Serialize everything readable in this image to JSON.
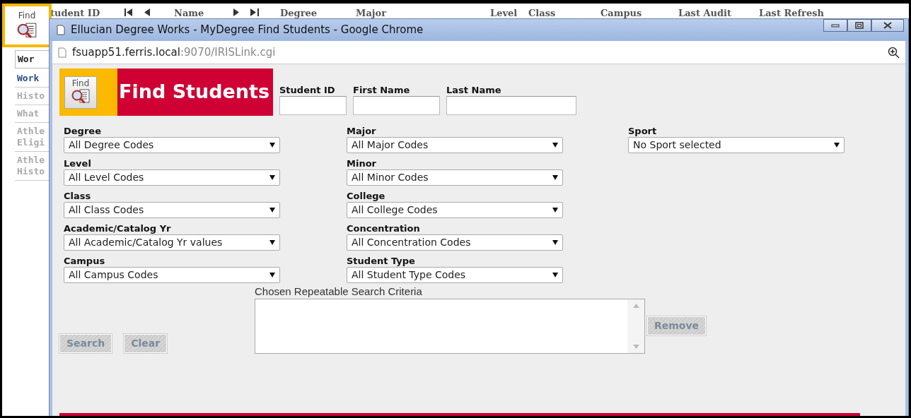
{
  "background_app": {
    "find_button": {
      "label": "Find"
    },
    "columns": [
      {
        "label": "tudent ID",
        "kind": "text"
      },
      {
        "kind": "nav_back"
      },
      {
        "label": "Name",
        "kind": "text"
      },
      {
        "kind": "nav_forward"
      },
      {
        "label": "Degree",
        "kind": "text"
      },
      {
        "label": "Major",
        "kind": "text"
      },
      {
        "label": "Level",
        "kind": "text"
      },
      {
        "label": "Class",
        "kind": "text"
      },
      {
        "label": "Campus",
        "kind": "text"
      },
      {
        "label": "Last Audit",
        "kind": "text"
      },
      {
        "label": "Last Refresh",
        "kind": "text"
      }
    ],
    "sidebar": {
      "items": [
        {
          "label": "Wor",
          "kind": "tab",
          "disabled": false
        },
        {
          "label": "Work",
          "kind": "link",
          "disabled": false
        },
        {
          "label": "Histo",
          "kind": "link",
          "disabled": true
        },
        {
          "label": "What",
          "kind": "link",
          "disabled": true
        },
        {
          "label": "Athle\nEligi",
          "kind": "link",
          "disabled": true
        },
        {
          "label": "Athle\nHisto",
          "kind": "link",
          "disabled": true
        }
      ]
    }
  },
  "window": {
    "title": "Ellucian Degree Works - MyDegree Find Students - Google Chrome",
    "address": {
      "host": "fsuapp51.ferris.local",
      "path": ":9070/IRISLink.cgi"
    },
    "header": {
      "icon_label": "Find",
      "title": "Find Students"
    },
    "search_fields": [
      {
        "label": "Student ID"
      },
      {
        "label": "First Name"
      },
      {
        "label": "Last Name"
      }
    ],
    "filter_columns": [
      [
        {
          "label": "Degree",
          "value": "All Degree Codes"
        },
        {
          "label": "Level",
          "value": "All Level Codes"
        },
        {
          "label": "Class",
          "value": "All Class Codes"
        },
        {
          "label": "Academic/Catalog Yr",
          "value": "All Academic/Catalog Yr values"
        },
        {
          "label": "Campus",
          "value": "All Campus Codes"
        }
      ],
      [
        {
          "label": "Major",
          "value": "All Major Codes"
        },
        {
          "label": "Minor",
          "value": "All Minor Codes"
        },
        {
          "label": "College",
          "value": "All College Codes"
        },
        {
          "label": "Concentration",
          "value": "All Concentration Codes"
        },
        {
          "label": "Student Type",
          "value": "All Student Type Codes"
        }
      ],
      [
        {
          "label": "Sport",
          "value": "No Sport selected"
        }
      ]
    ],
    "criteria": {
      "label": "Chosen Repeatable Search Criteria"
    },
    "buttons": [
      {
        "label": "Search",
        "disabled": true
      },
      {
        "label": "Clear",
        "disabled": true
      }
    ],
    "remove_button": {
      "label": "Remove",
      "disabled": true
    }
  }
}
